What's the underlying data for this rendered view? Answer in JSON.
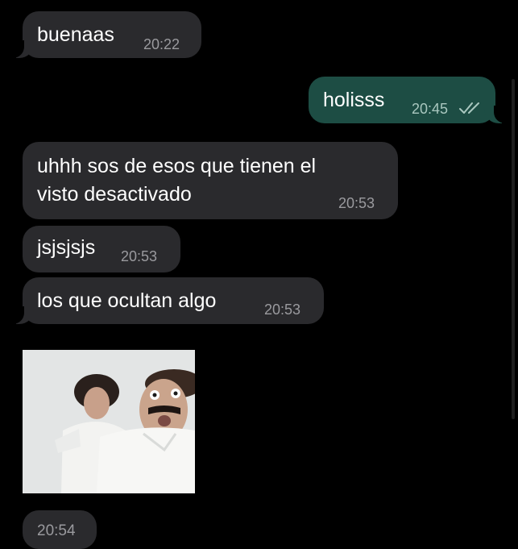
{
  "messages": [
    {
      "id": "m1",
      "direction": "incoming",
      "text": "buenaas",
      "time": "20:22"
    },
    {
      "id": "m2",
      "direction": "outgoing",
      "text": "holisss",
      "time": "20:45",
      "status_icon": "double-check-icon"
    },
    {
      "id": "m3",
      "direction": "incoming",
      "text_line1": "uhhh sos de esos que tienen el",
      "text_line2": "visto desactivado",
      "time": "20:53"
    },
    {
      "id": "m4",
      "direction": "incoming",
      "text": "jsjsjsjs",
      "time": "20:53"
    },
    {
      "id": "m5",
      "direction": "incoming",
      "text": "los que ocultan algo",
      "time": "20:53"
    },
    {
      "id": "m6",
      "direction": "incoming",
      "type": "image",
      "image_icon": "meme-photo-icon",
      "time": "20:54"
    }
  ],
  "colors": {
    "background": "#000000",
    "incoming_bubble": "#2a2a2d",
    "outgoing_bubble": "#1d4d44",
    "text": "#ffffff",
    "timestamp": "#9a9a9e"
  }
}
